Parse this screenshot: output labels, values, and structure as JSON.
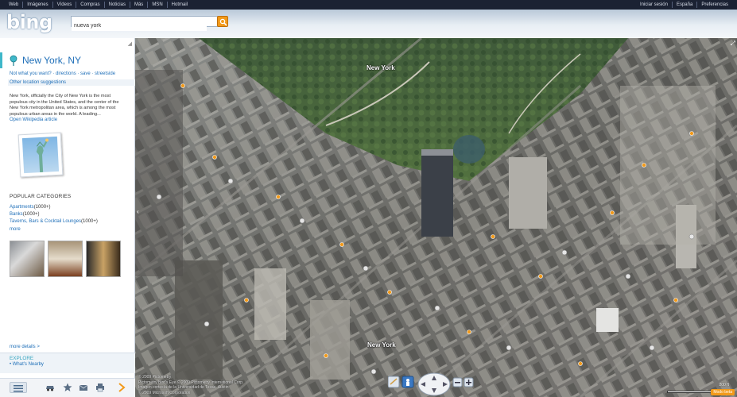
{
  "topnav": {
    "left": [
      "Web",
      "Imágenes",
      "Vídeos",
      "Compras",
      "Noticias",
      "Más",
      "MSN",
      "Hotmail"
    ],
    "right": [
      "Iniciar sesión",
      "España",
      "Preferencias"
    ]
  },
  "header": {
    "logo": "bing",
    "search": {
      "value": "nueva york",
      "placeholder": ""
    }
  },
  "sidebar": {
    "title": "New York, NY",
    "links": "Not what you want? · directions · save · streetside",
    "other_suggestions": "Other location suggestions",
    "description": "New York, officially the City of New York is the most populous city in the United States, and the center of the New York metropolitan area, which is among the most populous urban areas in the world. A leading...",
    "wiki_link": "Open Wikipedia article",
    "popular_categories_title": "POPULAR CATEGORIES",
    "categories": [
      {
        "name": "Apartments",
        "count": "(1000+)"
      },
      {
        "name": "Banks",
        "count": "(1000+)"
      },
      {
        "name": "Taverns, Bars & Cocktail Lounges",
        "count": "(1000+)"
      }
    ],
    "more": "more",
    "more_details": "more details >",
    "explore_title": "EXPLORE",
    "explore_nearby": "• What's Nearby",
    "tools": [
      "list-icon",
      "car-icon",
      "star-icon",
      "mail-icon",
      "print-icon",
      "arrow-right-icon"
    ]
  },
  "map": {
    "labels": [
      {
        "text": "New York"
      },
      {
        "text": "New York"
      }
    ],
    "copyright_lines": [
      "© 2009 Pictometry",
      "Pictometry Bird's Eye © 2009 Pictometry International Corp.",
      "Imagen cortesía de la Universidad de Texas, Austin",
      "© 2009 Microsoft Corporation"
    ],
    "scale_label": "200 ft",
    "feedback": "Modo beta",
    "accent": "#f29a1a"
  }
}
